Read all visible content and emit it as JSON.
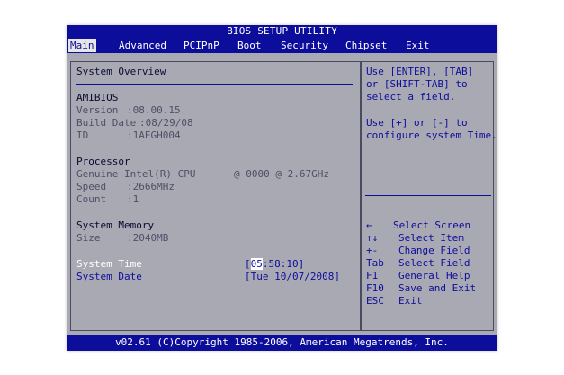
{
  "title": "BIOS SETUP UTILITY",
  "menu": [
    {
      "label": "Main",
      "active": true
    },
    {
      "label": "Advanced"
    },
    {
      "label": "PCIPnP"
    },
    {
      "label": "Boot"
    },
    {
      "label": "Security"
    },
    {
      "label": "Chipset"
    },
    {
      "label": "Exit"
    }
  ],
  "overview": {
    "heading": "System Overview",
    "amibios": {
      "heading": "AMIBIOS",
      "version_label": "Version",
      "version_value": ":08.00.15",
      "build_label": "Build Date",
      "build_value": ":08/29/08",
      "id_label": "ID",
      "id_value": ":1AEGH004"
    },
    "processor": {
      "heading": "Processor",
      "name": "Genuine Intel(R) CPU",
      "freq": "@ 0000 @ 2.67GHz",
      "speed_label": "Speed",
      "speed_value": ":2666MHz",
      "count_label": "Count",
      "count_value": ":1"
    },
    "memory": {
      "heading": "System Memory",
      "size_label": "Size",
      "size_value": ":2040MB"
    },
    "time": {
      "label": "System Time",
      "open": "[",
      "cursor": "05",
      "rest": ":58:10]"
    },
    "date": {
      "label": "System Date",
      "value": "[Tue 10/07/2008]"
    }
  },
  "help": {
    "lines": [
      "Use [ENTER], [TAB]",
      "or [SHIFT-TAB] to",
      "select a field.",
      "",
      "Use [+] or [-] to",
      "configure system Time."
    ],
    "keys": [
      {
        "key": "←",
        "desc": "Select Screen"
      },
      {
        "key": "↑↓",
        "desc": "Select Item"
      },
      {
        "key": "+-",
        "desc": "Change Field"
      },
      {
        "key": "Tab",
        "desc": "Select Field"
      },
      {
        "key": "F1",
        "desc": "General Help"
      },
      {
        "key": "F10",
        "desc": "Save and Exit"
      },
      {
        "key": "ESC",
        "desc": "Exit"
      }
    ]
  },
  "footer": "v02.61 (C)Copyright 1985-2006, American Megatrends, Inc.",
  "colors": {
    "bios_blue": "#0d0d9c",
    "panel_gray": "#a9a9b4",
    "value_gray": "#4f4f66"
  }
}
